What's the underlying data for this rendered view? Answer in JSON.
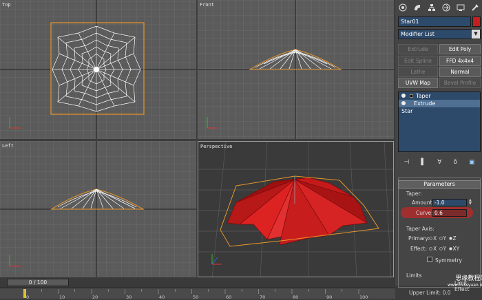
{
  "viewports": {
    "top": "Top",
    "front": "Front",
    "left": "Left",
    "perspective": "Perspective"
  },
  "panel": {
    "icons": [
      "create-icon",
      "modify-icon",
      "hierarchy-icon",
      "motion-icon",
      "display-icon",
      "utilities-icon"
    ],
    "object_name": "Star01",
    "object_color": "#c31f1f",
    "modifier_list": "Modifier List",
    "buttons": {
      "extrude": "Extrude",
      "edit_poly": "Edit Poly",
      "edit_spline": "Edit Spline",
      "ffd": "FFD 4x4x4",
      "lathe": "Lathe",
      "normal": "Normal",
      "uvw_map": "UVW Map",
      "bevel_profile": "Bevel Profile"
    },
    "stack": [
      "Taper",
      "Extrude",
      "Star"
    ],
    "rollout_title": "Parameters",
    "taper_group": "Taper:",
    "amount_label": "Amount:",
    "amount_value": "-1.0",
    "curve_label": "Curve:",
    "curve_value": "0.6",
    "taper_axis_group": "Taper Axis:",
    "primary_label": "Primary:",
    "effect_label": "Effect:",
    "primary_opts": [
      "X",
      "Y",
      "Z"
    ],
    "effect_opts": [
      "X",
      "Y",
      "XY"
    ],
    "symmetry": "Symmetry",
    "limits": "Limits",
    "limit_effect": "Limit Effect",
    "upper_limit": "Upper Limit: 0.0"
  },
  "timeline": {
    "slider": "0 / 100",
    "ticks": [
      "0",
      "10",
      "20",
      "30",
      "40",
      "50",
      "60",
      "70",
      "80",
      "90",
      "100"
    ]
  },
  "watermark": {
    "line1": "思缘教程网",
    "line2": "www.missyuan.net"
  }
}
